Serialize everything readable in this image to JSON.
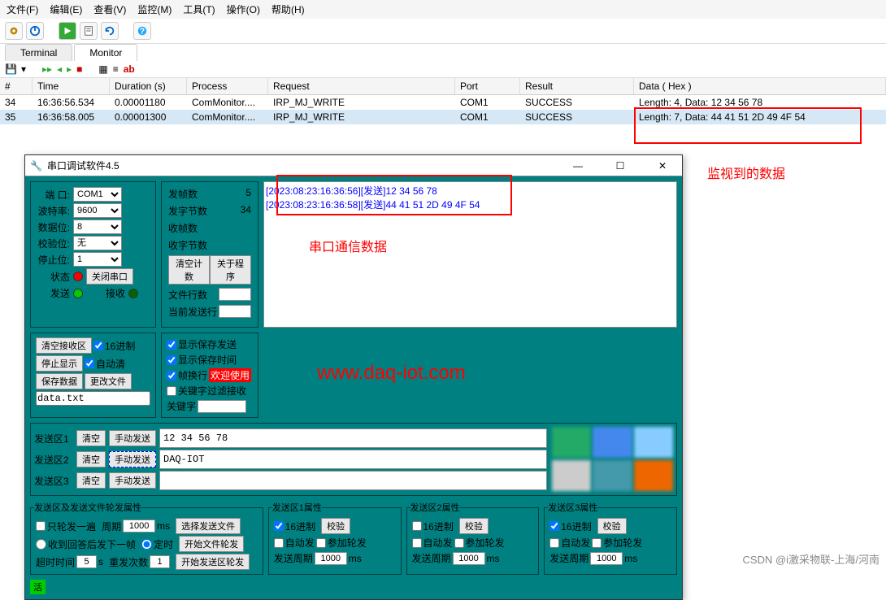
{
  "menu": {
    "file": "文件(F)",
    "edit": "编辑(E)",
    "view": "查看(V)",
    "monitor": "监控(M)",
    "tools": "工具(T)",
    "operate": "操作(O)",
    "help": "帮助(H)"
  },
  "tabs": {
    "terminal": "Terminal",
    "monitor": "Monitor"
  },
  "toolbar2": {
    "ab": "ab"
  },
  "columns": {
    "hash": "#",
    "time": "Time",
    "duration": "Duration (s)",
    "process": "Process",
    "request": "Request",
    "port": "Port",
    "result": "Result",
    "data": "Data ( Hex )"
  },
  "rows": [
    {
      "n": "34",
      "time": "16:36:56.534",
      "dur": "0.00001180",
      "proc": "ComMonitor....",
      "req": "IRP_MJ_WRITE",
      "port": "COM1",
      "res": "SUCCESS",
      "data": "Length: 4, Data: 12 34 56 78"
    },
    {
      "n": "35",
      "time": "16:36:58.005",
      "dur": "0.00001300",
      "proc": "ComMonitor....",
      "req": "IRP_MJ_WRITE",
      "port": "COM1",
      "res": "SUCCESS",
      "data": "Length: 7, Data: 44 41 51 2D 49 4F 54"
    }
  ],
  "annot": {
    "monitored": "监视到的数据",
    "serialdata": "串口通信数据",
    "url": "www.daq-iot.com"
  },
  "sw": {
    "title": "串口调试软件4.5",
    "config": {
      "port_l": "端 口:",
      "port": "COM1",
      "baud_l": "波特率:",
      "baud": "9600",
      "databit_l": "数据位:",
      "databit": "8",
      "parity_l": "校验位:",
      "parity": "无",
      "stopbit_l": "停止位:",
      "stopbit": "1",
      "status_l": "状态",
      "close_btn": "关闭串口",
      "send_l": "发送",
      "recv_l": "接收"
    },
    "stats": {
      "sent_frames_l": "发帧数",
      "sent_frames": "5",
      "sent_bytes_l": "发字节数",
      "sent_bytes": "34",
      "recv_frames_l": "收帧数",
      "recv_frames": "",
      "recv_bytes_l": "收字节数",
      "recv_bytes": "",
      "clear_btn": "清空计数",
      "about_btn": "关于程序",
      "file_lines_l": "文件行数",
      "cur_line_l": "当前发送行"
    },
    "log": {
      "l1_time": "[2023:08:23:16:36:56]",
      "l1_tag": "[发送]",
      "l1_data": "12 34 56 78",
      "l2_time": "[2023:08:23:16:36:58]",
      "l2_tag": "[发送]",
      "l2_data": "44 41 51 2D 49 4F 54"
    },
    "opts": {
      "clear_recv": "清空接收区",
      "hex16": "16进制",
      "stop_show": "停止显示",
      "auto_clear": "自动清",
      "save_data": "保存数据",
      "change_file": "更改文件",
      "filename": "data.txt"
    },
    "save": {
      "show_send": "显示保存发送",
      "show_time": "显示保存时间",
      "wrap": "帧换行",
      "welcome": "欢迎使用",
      "filter": "关键字过滤接收",
      "keyword_l": "关键字"
    },
    "send": {
      "area1_l": "发送区1",
      "area2_l": "发送区2",
      "area3_l": "发送区3",
      "clear_btn": "清空",
      "manual_btn": "手动发送",
      "area1_val": "12 34 56 78",
      "area2_val": "DAQ-IOT",
      "area3_val": ""
    },
    "bottom": {
      "grp0_title": "发送区及发送文件轮发属性",
      "once": "只轮发一遍",
      "period_l": "周期",
      "period": "1000",
      "ms": "ms",
      "select_file": "选择发送文件",
      "after_reply": "收到回答后发下一帧",
      "timer": "定时",
      "start_file": "开始文件轮发",
      "timeout_l": "超时时间",
      "timeout": "5",
      "sec": "s",
      "retry_l": "重发次数",
      "retry": "1",
      "start_area": "开始发送区轮发",
      "grp1_title": "发送区1属性",
      "grp2_title": "发送区2属性",
      "grp3_title": "发送区3属性",
      "hex16": "16进制",
      "verify": "校验",
      "autosend": "自动发",
      "join": "参加轮发",
      "send_period_l": "发送周期",
      "send_period": "1000"
    },
    "footer": "活"
  },
  "watermark": "CSDN @i激采物联-上海/河南"
}
